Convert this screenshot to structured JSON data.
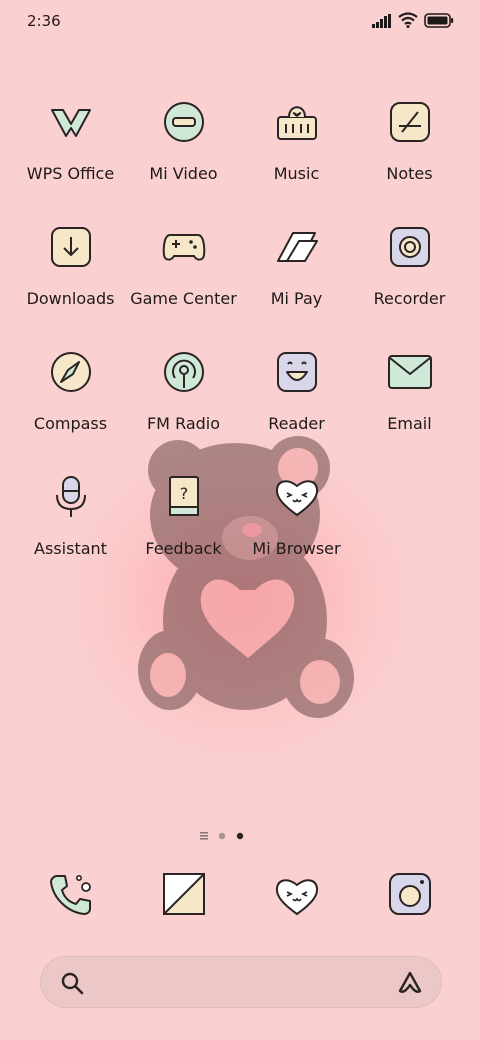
{
  "status_bar": {
    "time": "2:36"
  },
  "apps": [
    {
      "label": "WPS Office",
      "icon": "wps-office-icon"
    },
    {
      "label": "Mi Video",
      "icon": "mi-video-icon"
    },
    {
      "label": "Music",
      "icon": "music-icon"
    },
    {
      "label": "Notes",
      "icon": "notes-icon"
    },
    {
      "label": "Downloads",
      "icon": "downloads-icon"
    },
    {
      "label": "Game Center",
      "icon": "game-center-icon"
    },
    {
      "label": "Mi Pay",
      "icon": "mi-pay-icon"
    },
    {
      "label": "Recorder",
      "icon": "recorder-icon"
    },
    {
      "label": "Compass",
      "icon": "compass-icon"
    },
    {
      "label": "FM Radio",
      "icon": "fm-radio-icon"
    },
    {
      "label": "Reader",
      "icon": "reader-icon"
    },
    {
      "label": "Email",
      "icon": "email-icon"
    },
    {
      "label": "Assistant",
      "icon": "assistant-icon"
    },
    {
      "label": "Feedback",
      "icon": "feedback-icon"
    },
    {
      "label": "Mi Browser",
      "icon": "mi-browser-icon"
    }
  ],
  "page_indicator": {
    "pages": 3,
    "current_page": 3
  },
  "dock": [
    {
      "icon": "phone-icon"
    },
    {
      "icon": "messages-icon"
    },
    {
      "icon": "browser-heart-icon"
    },
    {
      "icon": "camera-icon"
    }
  ],
  "search": {
    "placeholder": ""
  },
  "colors": {
    "background": "#fbd0d0",
    "icon_fill_green": "#cfe8d8",
    "icon_fill_cream": "#f6e7c8",
    "icon_fill_lavender": "#d9d6ea",
    "outline": "#2b2424"
  }
}
